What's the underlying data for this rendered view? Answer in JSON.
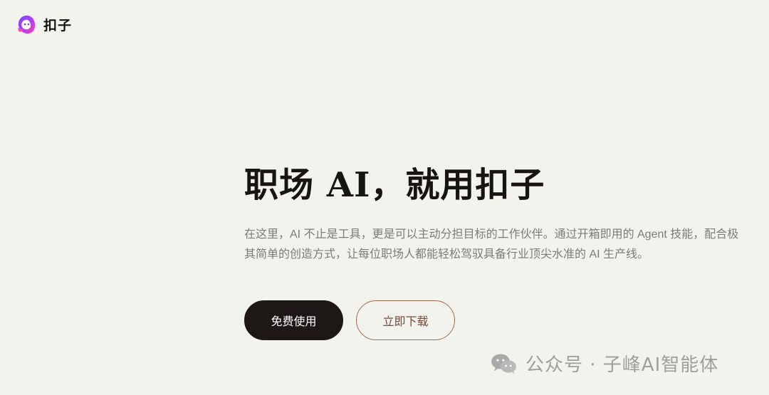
{
  "header": {
    "logo_text": "扣子"
  },
  "hero": {
    "title": "职场 AI，就用扣子",
    "description": "在这里，AI 不止是工具，更是可以主动分担目标的工作伙伴。通过开箱即用的 Agent 技能，配合极其简单的创造方式，让每位职场人都能轻松驾驭具备行业顶尖水准的 AI 生产线。"
  },
  "actions": {
    "primary_label": "免费使用",
    "secondary_label": "立即下载"
  },
  "watermark": {
    "text": "公众号 · 子峰AI智能体",
    "icon": "wechat-icon"
  },
  "colors": {
    "background": "#f3f3ee",
    "primary_button": "#1d1715",
    "secondary_border": "#a06a51",
    "description_text": "#7c7b78"
  }
}
